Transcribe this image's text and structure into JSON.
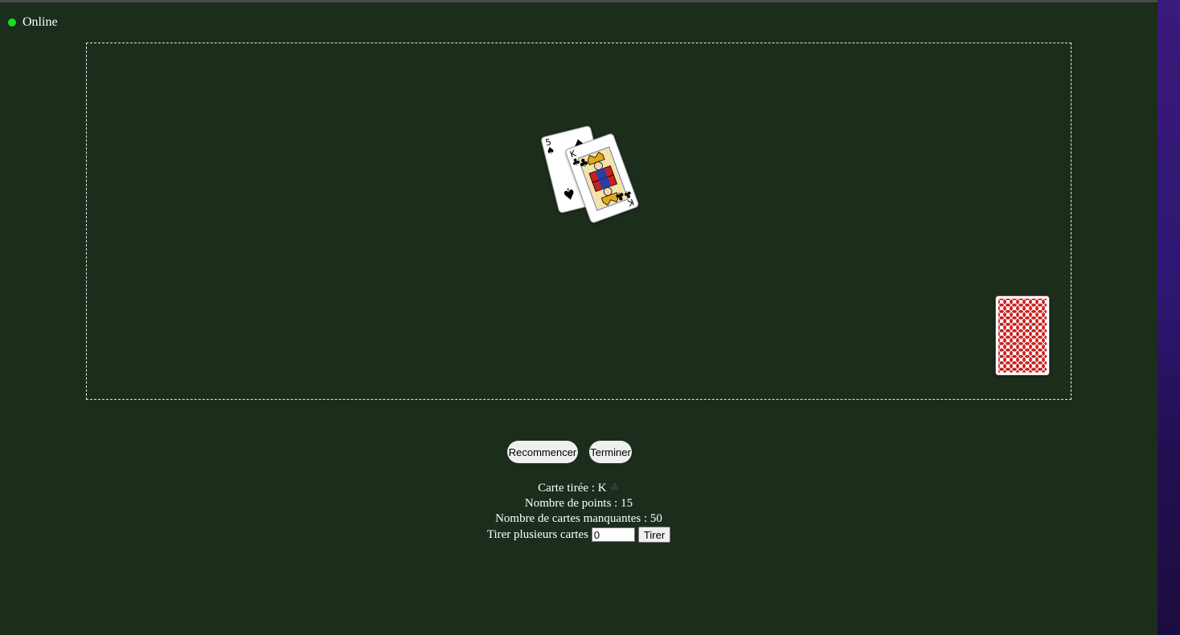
{
  "status": {
    "label": "Online",
    "color": "#14e01c"
  },
  "table": {
    "played_cards": [
      {
        "rank": "5",
        "suit": "♠",
        "suit_name": "spades"
      },
      {
        "rank": "K",
        "suit": "♣",
        "suit_name": "clubs"
      }
    ],
    "deck": {
      "back_color": "#c8201f"
    }
  },
  "controls": {
    "restart_label": "Recommencer",
    "end_label": "Terminer"
  },
  "info": {
    "drawn_card_label": "Carte tirée :",
    "drawn_card_rank": "K",
    "drawn_card_suit": "♣",
    "points_label": "Nombre de points :",
    "points_value": "15",
    "missing_label": "Nombre de cartes manquantes :",
    "missing_value": "50",
    "draw_many_label": "Tirer plusieurs cartes",
    "draw_many_value": "0",
    "draw_button_label": "Tirer"
  }
}
